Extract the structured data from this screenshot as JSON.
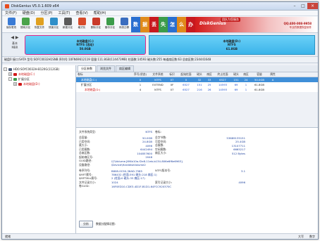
{
  "window": {
    "title": "DiskGenius V5.0.1.609 x64"
  },
  "menu": [
    "文件(F)",
    "硬盘(D)",
    "分区(P)",
    "工具(T)",
    "查看(V)",
    "帮助(H)"
  ],
  "toolbar": [
    {
      "label": "保存更改",
      "color": "#3a7bd5",
      "icon": "save-icon"
    },
    {
      "label": "搜索分区",
      "color": "#4aa34a",
      "icon": "search-icon"
    },
    {
      "label": "恢复文件",
      "color": "#e0a020",
      "icon": "recover-icon"
    },
    {
      "label": "快速分区",
      "color": "#2f8fc9",
      "icon": "partition-icon"
    },
    {
      "label": "新建分区",
      "color": "#5a5a5a",
      "icon": "new-partition-icon"
    },
    {
      "label": "格式化",
      "color": "#d84a2a",
      "icon": "format-icon"
    },
    {
      "label": "删除分区",
      "color": "#c93a2a",
      "icon": "delete-icon"
    },
    {
      "label": "备份分区",
      "color": "#3b9c4a",
      "icon": "backup-icon"
    },
    {
      "label": "系统迁移",
      "color": "#3a6dbf",
      "icon": "migrate-icon"
    }
  ],
  "banner": {
    "tiles": [
      {
        "text": "数",
        "color": "#2a6fd0"
      },
      {
        "text": "据",
        "color": "#e08a1a"
      },
      {
        "text": "丢",
        "color": "#c7181e"
      },
      {
        "text": "失",
        "color": "#3b9c4a"
      },
      {
        "text": "怎",
        "color": "#2a6fd0"
      },
      {
        "text": "么",
        "color": "#e08a1a"
      },
      {
        "text": "办",
        "color": "#c7181e"
      }
    ],
    "logo": "DiskGenius",
    "slogan": "团队为您服务",
    "phone": "QQ:400-008-9958",
    "url": "专业的数据恢复软件"
  },
  "nav": {
    "line1": "基本",
    "line2": "MBR"
  },
  "disk_partitions": [
    {
      "name": "本地磁盘(C:)",
      "fs": "NTFS (活动)",
      "size": "50.0GB"
    },
    {
      "name": "本地磁盘(D:)",
      "fs": "NTFS",
      "size": "61.8GB"
    }
  ],
  "disk_info": "磁盘0 接口:SATA 型号:SOFC0032H1SNB 序列号:10FN69612119 容量:111.8GB(114473MB) 柱面数:14593 磁头数:255 每道扇区数:63 总扇区数:234441648",
  "tree": [
    {
      "label": "HD0:SOYC0032H-B120G(112GB)",
      "level": 0,
      "exp": "-",
      "color": "#4a5a78",
      "cls": ""
    },
    {
      "label": "本地磁盘(C:)",
      "level": 1,
      "exp": "+",
      "color": "#d01818",
      "cls": "red"
    },
    {
      "label": "扩展分区",
      "level": 1,
      "exp": "-",
      "color": "#3b9c4a",
      "cls": ""
    },
    {
      "label": "本地磁盘(D:)",
      "level": 2,
      "exp": "+",
      "color": "#d01818",
      "cls": "red"
    }
  ],
  "tabs": [
    "分区参数",
    "浏览文件",
    "扇区编辑"
  ],
  "table": {
    "headers": [
      "卷标",
      "序号(状态)",
      "文件系统",
      "标识",
      "起始柱面",
      "磁头",
      "扇区",
      "终止柱面",
      "磁头",
      "扇区",
      "容量",
      "属性"
    ],
    "rows": [
      {
        "cells": [
          "本地磁盘(C:)",
          "0",
          "NTFS",
          "07",
          "0",
          "32",
          "33",
          "6527",
          "151",
          "24",
          "50.0GB",
          "A"
        ],
        "sel": true,
        "indent": 1
      },
      {
        "cells": [
          "扩展分区",
          "1",
          "EXTEND",
          "0F",
          "6527",
          "151",
          "25",
          "14593",
          "69",
          "1",
          "61.8GB",
          ""
        ],
        "sel": false,
        "indent": 1
      },
      {
        "cells": [
          "本地磁盘(D:)",
          "4",
          "NTFS",
          "07",
          "6527",
          "216",
          "26",
          "14593",
          "69",
          "1",
          "61.8GB",
          ""
        ],
        "sel": false,
        "indent": 2
      }
    ]
  },
  "details": {
    "fs_type_label": "文件系统类型:",
    "fs_type": "NTFS",
    "vol_label_label": "卷标:",
    "rows": [
      [
        "总容量:",
        "50.0GB",
        "总字节数:",
        "53689135151"
      ],
      [
        "已用空间:",
        "24.8GB",
        "可用空间:",
        "25.4GB"
      ],
      [
        "簇大小:",
        "4096",
        "总簇数:",
        "13107711"
      ],
      [
        "已用簇数:",
        "6442494",
        "空闲簇数:",
        "6665217"
      ],
      [
        "总扇区数:",
        "104857600",
        "扇区大小:",
        "512 Bytes"
      ],
      [
        "起始扇区号:",
        "2048",
        "",
        ""
      ]
    ],
    "guid_label": "GUID路径:",
    "guid": "\\\\?\\Volume{6f4b10a-f2e8-11eb-b134-806e6f6e6963}",
    "dev_label": "设备路径:",
    "dev": "\\Device\\HarddiskVolume2",
    "rows2": [
      [
        "卷序列号:",
        "B808-0C90-36AD-7585",
        "NTFS版本号:",
        "3.1"
      ],
      [
        "$MFT簇号:",
        "786432 (柱面:391 磁头:218 扇区:1)",
        "",
        ""
      ],
      [
        "$MFTMirr簇号:",
        "2 (柱面:0 磁头:33 扇区:17)",
        "",
        ""
      ],
      [
        "文件记录大小:",
        "1024",
        "索引记录大小:",
        "4096"
      ],
      [
        "卷GUID:",
        "16F0ED10-CDE3-4D1F-B1D1-64FCC920370C",
        "",
        ""
      ]
    ],
    "analyze_btn": "分析",
    "analyze_text": "数据分配情况图:"
  },
  "status": {
    "left": "就绪",
    "right1": "大写",
    "right2": "数字"
  }
}
